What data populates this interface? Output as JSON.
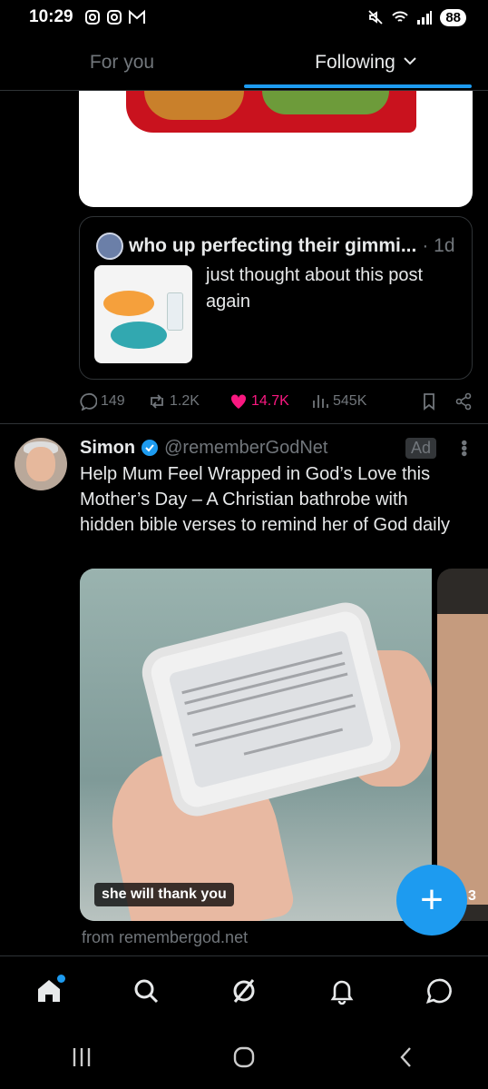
{
  "status_bar": {
    "time": "10:29",
    "battery": "88"
  },
  "header": {
    "tabs": [
      {
        "label": "For you"
      },
      {
        "label": "Following"
      }
    ]
  },
  "quoted_post": {
    "author": "who up perfecting their gimmi...",
    "time": "· 1d",
    "text": "just thought about this post again"
  },
  "engagement": {
    "replies": "149",
    "reposts": "1.2K",
    "likes": "14.7K",
    "views": "545K"
  },
  "ad_post": {
    "name": "Simon",
    "handle": "@rememberGodNet",
    "badge": "Ad",
    "text": "Help Mum Feel Wrapped in God’s Love this Mother’s Day – A Christian bathrobe with hidden bible verses to remind her of God daily",
    "media_caption": "she will thank you",
    "next_media_label": "3",
    "source": "from remembergod.net"
  },
  "fab": {
    "label": "+"
  },
  "colors": {
    "accent": "#1d9bf0",
    "like": "#f91880",
    "muted": "#71767b",
    "border": "#2f3336"
  },
  "nav_icons": [
    "home-icon",
    "search-icon",
    "grok-icon",
    "notifications-icon",
    "messages-icon"
  ]
}
